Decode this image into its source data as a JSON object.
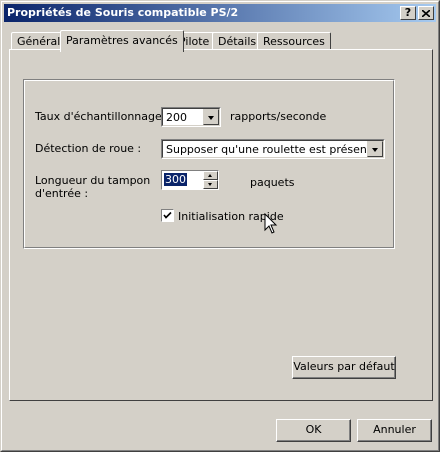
{
  "window": {
    "title": "Propriétés de Souris compatible PS/2",
    "help_button": "?",
    "close_button": "X"
  },
  "tabs": [
    {
      "label": "Général",
      "active": false
    },
    {
      "label": "Paramètres avancés",
      "active": true
    },
    {
      "label": "Pilote",
      "active": false
    },
    {
      "label": "Détails",
      "active": false
    },
    {
      "label": "Ressources",
      "active": false
    }
  ],
  "settings": {
    "sample_rate_label": "Taux d'échantillonnage :",
    "sample_rate_value": "200",
    "sample_rate_unit": "rapports/seconde",
    "wheel_detection_label": "Détection de roue :",
    "wheel_detection_value": "Supposer qu'une roulette est présente",
    "buffer_length_label_line1": "Longueur du tampon",
    "buffer_length_label_line2": "d'entrée :",
    "buffer_length_value": "300",
    "buffer_length_unit": "paquets",
    "fast_init_label": "Initialisation rapide",
    "fast_init_checked": true
  },
  "buttons": {
    "defaults": "Valeurs par défaut",
    "ok": "OK",
    "cancel": "Annuler"
  }
}
